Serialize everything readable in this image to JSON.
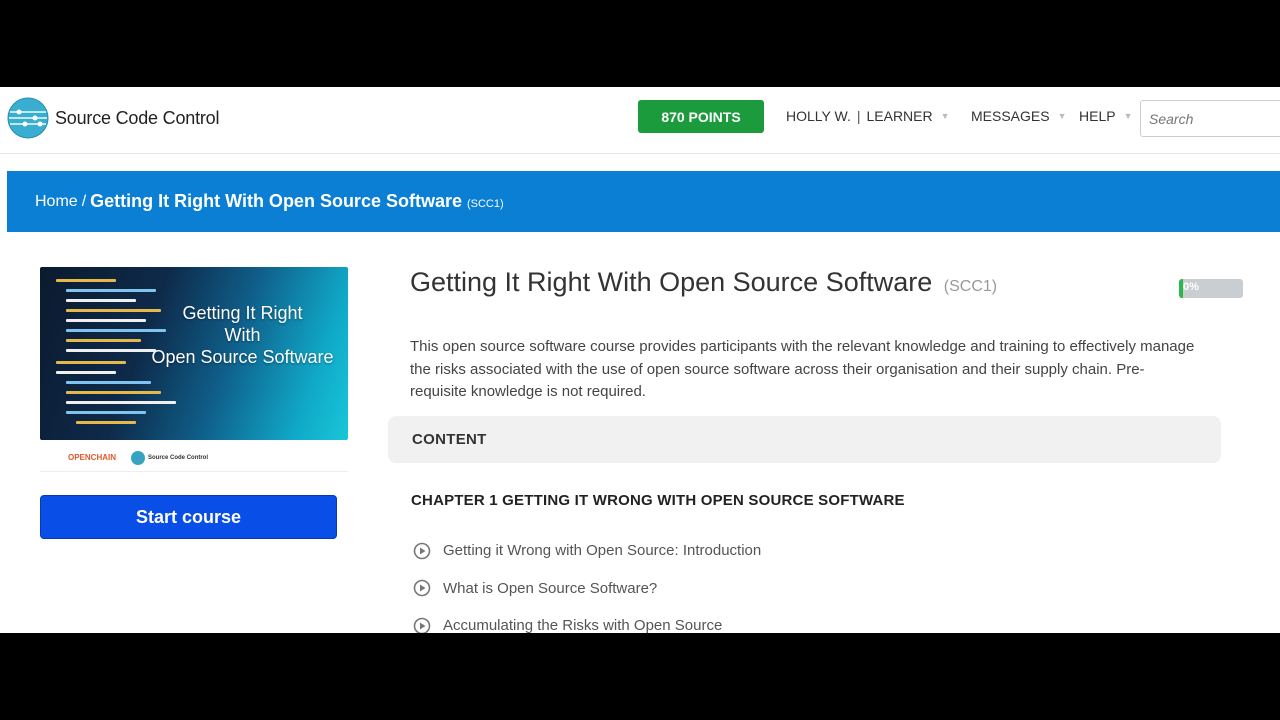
{
  "header": {
    "logo_text": "Source Code Control",
    "points": "870 POINTS",
    "user_name": "HOLLY W.",
    "user_role": "LEARNER",
    "messages_label": "MESSAGES",
    "help_label": "HELP",
    "search_placeholder": "Search"
  },
  "breadcrumb": {
    "home": "Home",
    "separator": "/",
    "current": "Getting It Right With Open Source Software",
    "code": "(SCC1)"
  },
  "course_card": {
    "image_title_line1": "Getting It Right",
    "image_title_line2": "With",
    "image_title_line3": "Open Source Software",
    "start_button": "Start course"
  },
  "course": {
    "title": "Getting It Right With Open Source Software",
    "code": "(SCC1)",
    "progress_percent": 0,
    "progress_label": "0%",
    "description": "This open source software course provides participants with the relevant knowledge and training to effectively manage the risks associated with the use of open source software across their organisation and their supply chain. Pre-requisite knowledge is not required."
  },
  "content": {
    "section_label": "CONTENT",
    "chapter_title": "CHAPTER 1 GETTING IT WRONG WITH OPEN SOURCE SOFTWARE",
    "lessons": [
      "Getting it Wrong with Open Source: Introduction",
      "What is Open Source Software?",
      "Accumulating the Risks with Open Source"
    ]
  },
  "colors": {
    "points_green": "#1c9b3c",
    "banner_blue": "#0a7fd4",
    "start_button_blue": "#0a4ee8",
    "progress_green": "#2cb84a"
  }
}
